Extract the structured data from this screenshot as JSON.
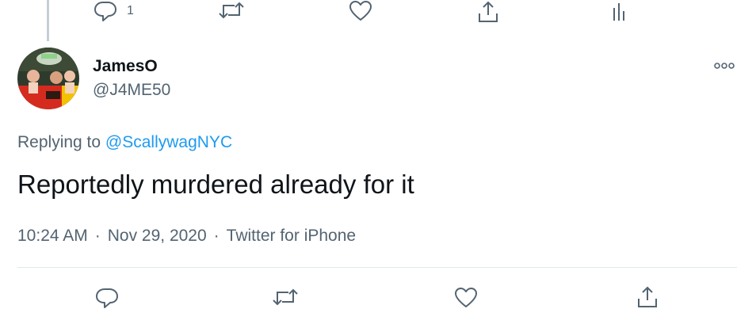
{
  "parent_tweet": {
    "reply_count": "1"
  },
  "tweet": {
    "display_name": "JamesO",
    "handle": "@J4ME50",
    "replying_prefix": "Replying to",
    "replying_to": "@ScallywagNYC",
    "text": "Reportedly murdered already for it",
    "time": "10:24 AM",
    "date": "Nov 29, 2020",
    "source": "Twitter for iPhone",
    "separator": "·"
  },
  "icons": {
    "reply": "speech-bubble-icon",
    "retweet": "retweet-arrows-icon",
    "like": "heart-icon",
    "share": "share-upload-icon",
    "analytics": "bar-chart-icon",
    "more": "more-options-icon"
  },
  "colors": {
    "text_primary": "#0f1419",
    "text_secondary": "#536471",
    "link": "#1d9bf0",
    "divider": "#e1e8ed",
    "thread_line": "#c4cfd6"
  }
}
